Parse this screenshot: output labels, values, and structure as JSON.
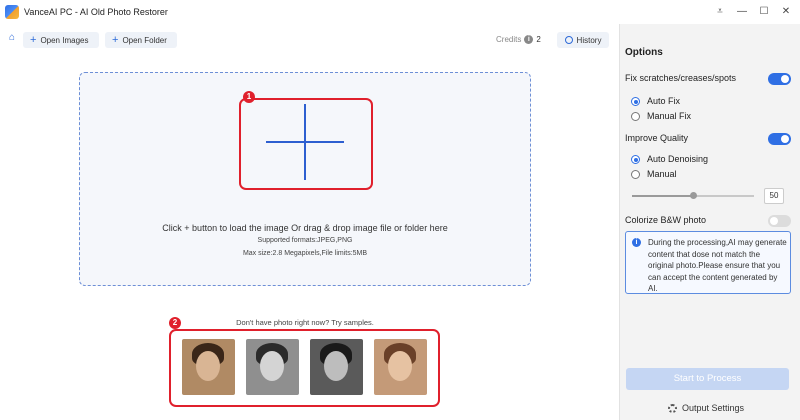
{
  "window": {
    "title": "VanceAI PC - AI Old Photo Restorer",
    "controls": [
      "pin-icon",
      "minimize-icon",
      "maximize-icon",
      "close-icon"
    ]
  },
  "toolbar": {
    "open_images": "Open Images",
    "open_folder": "Open Folder",
    "credits_label": "Credits",
    "credits_value": "2",
    "history": "History"
  },
  "dropzone": {
    "marker": "1",
    "hint": "Click + button to load the image Or drag & drop image file or folder here",
    "formats": "Supported formats:JPEG,PNG",
    "limits": "Max size:2.8 Megapixels,File limits:5MB"
  },
  "samples": {
    "marker": "2",
    "title": "Don't have photo right now? Try samples.",
    "count": 4
  },
  "options": {
    "title": "Options",
    "fix_label": "Fix scratches/creases/spots",
    "fix_enabled": true,
    "auto_fix": "Auto Fix",
    "manual_fix": "Manual Fix",
    "improve_label": "Improve Quality",
    "improve_enabled": true,
    "auto_denoising": "Auto Denoising",
    "manual": "Manual",
    "slider_value": "50",
    "slider_fraction": 0.5,
    "colorize_label": "Colorize B&W photo",
    "colorize_enabled": false,
    "notice": "During the processing,AI may generate content that dose not match the original photo.Please ensure that you can accept the content generated by AI.",
    "start_button": "Start to Process",
    "output_settings": "Output Settings"
  },
  "colors": {
    "accent": "#2f6fe4",
    "highlight": "#e0202c",
    "disabled_button": "#c5d6f3"
  }
}
